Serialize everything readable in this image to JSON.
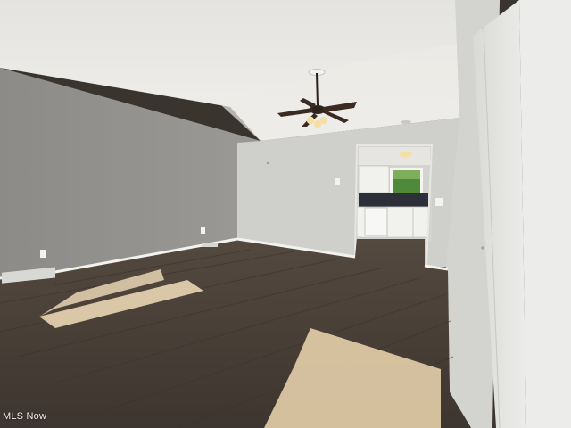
{
  "photo": {
    "subject": "empty-living-room-with-vaulted-ceiling",
    "watermark": "MLS Now"
  },
  "colors": {
    "ceiling": "#e9e8e4",
    "left_wall": "#8f8e8b",
    "back_wall": "#cfcfcb",
    "right_wall": "#e4e4e1",
    "floor": "#4a413a",
    "baseboard": "#f2f2ef",
    "sunlight": "#e9d6b4",
    "fan_blade": "#3a2a22",
    "fan_light": "#f6dfa4",
    "kitchen_cabinets": "#f1f1ee",
    "backsplash": "#2d3038",
    "window_view": "#4f8a3a"
  },
  "icons": {
    "fan": "ceiling-fan-icon",
    "light": "ceiling-light-icon"
  }
}
